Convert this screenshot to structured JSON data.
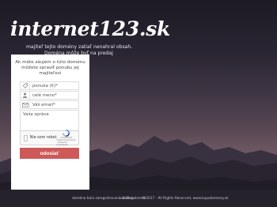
{
  "site": {
    "logo": "internet123.sk",
    "tagline1": "majiteľ tejto domény zatiaľ nenahral obsah.",
    "tagline2": "Doména môže byť na predaj"
  },
  "form": {
    "intro_line1": "Ak máte záujem o túto doménu",
    "intro_line2": "môžete spraviť ponuku jej",
    "intro_line3": "majiteľovi",
    "offer_placeholder": "ponuka (€)*",
    "name_placeholder": "celé meno*",
    "email_placeholder": "Váš email*",
    "message_placeholder": "Vaša správa",
    "captcha_label": "Nie som robot",
    "captcha_brand": "reCAPTCHA",
    "captcha_links": "Ochrana súkromia - Zmluvné podmienky",
    "submit_label": "odoslať"
  },
  "footer": {
    "left": "doména bola zaregistrovaná službou",
    "mid": "uložený.domén",
    "right": "©2017 · All Rights Reserved, www.kupadomeny.sk"
  },
  "colors": {
    "submit": "#cd5959",
    "panel": "#ffffff",
    "footer": "#25222b"
  }
}
